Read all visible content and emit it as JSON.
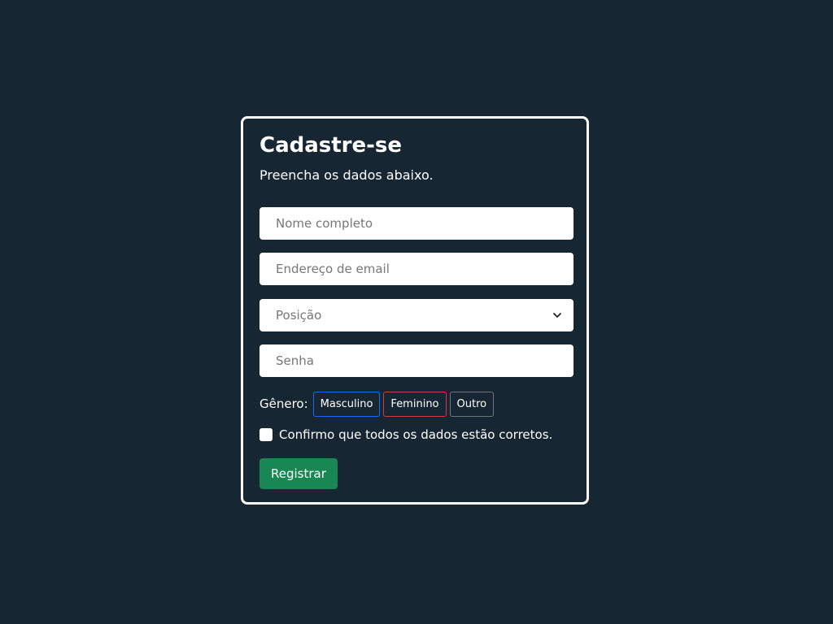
{
  "form": {
    "title": "Cadastre-se",
    "subtitle": "Preencha os dados abaixo.",
    "fields": {
      "name_placeholder": "Nome completo",
      "email_placeholder": "Endereço de email",
      "position_placeholder": "Posição",
      "password_placeholder": "Senha"
    },
    "gender": {
      "label": "Gênero:",
      "options": [
        "Masculino",
        "Feminino",
        "Outro"
      ]
    },
    "confirm_label": "Confirmo que todos os dados estão corretos.",
    "submit_label": "Registrar"
  },
  "colors": {
    "background": "#172633",
    "submit": "#198754",
    "male_border": "#0d6efd",
    "female_border": "#dc3545",
    "other_border": "#6c757d"
  },
  "icons": {
    "select_arrow": "chevron-down-icon"
  }
}
